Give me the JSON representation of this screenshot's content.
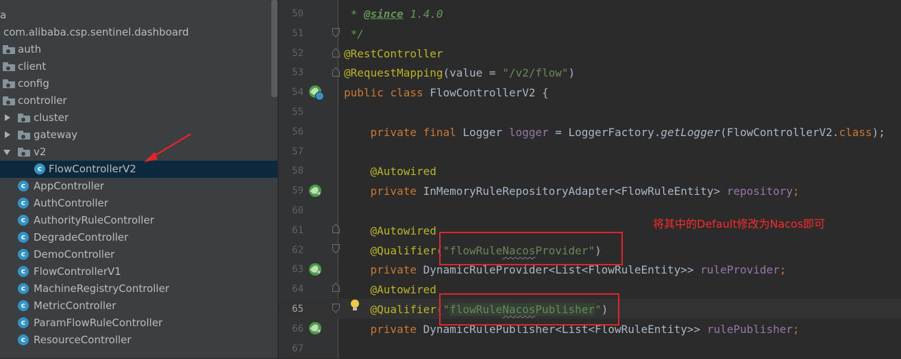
{
  "project_tree": {
    "items": [
      {
        "label": "a",
        "type": "text",
        "depth": 0
      },
      {
        "label": "com.alibaba.csp.sentinel.dashboard",
        "type": "package"
      },
      {
        "label": "auth",
        "type": "folder"
      },
      {
        "label": "client",
        "type": "folder"
      },
      {
        "label": "config",
        "type": "folder"
      },
      {
        "label": "controller",
        "type": "folder"
      },
      {
        "label": "cluster",
        "type": "folder",
        "expander": "collapsed"
      },
      {
        "label": "gateway",
        "type": "folder",
        "expander": "collapsed"
      },
      {
        "label": "v2",
        "type": "folder",
        "expander": "expanded"
      },
      {
        "label": "FlowControllerV2",
        "type": "class",
        "selected": true
      },
      {
        "label": "AppController",
        "type": "class"
      },
      {
        "label": "AuthController",
        "type": "class"
      },
      {
        "label": "AuthorityRuleController",
        "type": "class"
      },
      {
        "label": "DegradeController",
        "type": "class"
      },
      {
        "label": "DemoController",
        "type": "class"
      },
      {
        "label": "FlowControllerV1",
        "type": "class"
      },
      {
        "label": "MachineRegistryController",
        "type": "class"
      },
      {
        "label": "MetricController",
        "type": "class"
      },
      {
        "label": "ParamFlowRuleController",
        "type": "class"
      },
      {
        "label": "ResourceController",
        "type": "class"
      }
    ],
    "class_icon_letter": "c"
  },
  "editor": {
    "current_line": "65",
    "lines": [
      {
        "n": "50",
        "tokens": [
          [
            " * ",
            "cmt"
          ],
          [
            "@since",
            "tag"
          ],
          [
            " 1.4.0",
            "cmt"
          ]
        ]
      },
      {
        "n": "51",
        "tokens": [
          [
            " */",
            "cmt"
          ]
        ]
      },
      {
        "n": "52",
        "tokens": [
          [
            "@RestController",
            "ann"
          ]
        ]
      },
      {
        "n": "53",
        "tokens": [
          [
            "@RequestMapping",
            "ann"
          ],
          [
            "(value = ",
            ""
          ],
          [
            "\"/v2/flow\"",
            "str"
          ],
          [
            ")",
            ""
          ]
        ]
      },
      {
        "n": "54",
        "tokens": [
          [
            "public ",
            "kw"
          ],
          [
            "class ",
            "kw"
          ],
          [
            "FlowControllerV2 {",
            ""
          ]
        ]
      },
      {
        "n": "55",
        "tokens": []
      },
      {
        "n": "56",
        "tokens": [
          [
            "    ",
            ""
          ],
          [
            "private ",
            "kw"
          ],
          [
            "final ",
            "kw"
          ],
          [
            "Logger ",
            ""
          ],
          [
            "logger",
            "fld"
          ],
          [
            " = LoggerFactory.",
            ""
          ],
          [
            "getLogger",
            "mth"
          ],
          [
            "(FlowControllerV2.",
            ""
          ],
          [
            "class",
            "kw"
          ],
          [
            ");",
            ""
          ]
        ]
      },
      {
        "n": "57",
        "tokens": []
      },
      {
        "n": "58",
        "tokens": [
          [
            "    ",
            ""
          ],
          [
            "@Autowired",
            "ann"
          ]
        ]
      },
      {
        "n": "59",
        "tokens": [
          [
            "    ",
            ""
          ],
          [
            "private ",
            "kw"
          ],
          [
            "InMemoryRuleRepositoryAdapter<FlowRuleEntity> ",
            ""
          ],
          [
            "repository",
            "fld"
          ],
          [
            ";",
            "kw"
          ]
        ]
      },
      {
        "n": "60",
        "tokens": []
      },
      {
        "n": "61",
        "tokens": [
          [
            "    ",
            ""
          ],
          [
            "@Autowired",
            "ann"
          ]
        ]
      },
      {
        "n": "62",
        "tokens": [
          [
            "    ",
            ""
          ],
          [
            "@Qualifier",
            "ann"
          ],
          [
            "(",
            ""
          ],
          [
            "\"flowRule",
            "str"
          ],
          [
            "Nacos",
            "str typo"
          ],
          [
            "Provider\"",
            "str"
          ],
          [
            ")",
            ""
          ]
        ]
      },
      {
        "n": "63",
        "tokens": [
          [
            "    ",
            ""
          ],
          [
            "private ",
            "kw"
          ],
          [
            "DynamicRuleProvider<List<FlowRuleEntity>> ",
            ""
          ],
          [
            "ruleProvider",
            "fld"
          ],
          [
            ";",
            "kw"
          ]
        ]
      },
      {
        "n": "64",
        "tokens": [
          [
            "    ",
            ""
          ],
          [
            "@Autowired",
            "ann"
          ]
        ]
      },
      {
        "n": "65",
        "tokens": [
          [
            "    ",
            ""
          ],
          [
            "@Qualifier",
            "ann"
          ],
          [
            "(\"",
            "str"
          ],
          [
            "flowRule",
            "str hl-str"
          ],
          [
            "Nacos",
            "str typo hl-str"
          ],
          [
            "Publisher",
            "str hl-str"
          ],
          [
            "\"",
            "str"
          ],
          [
            ")",
            ""
          ]
        ]
      },
      {
        "n": "66",
        "tokens": [
          [
            "    ",
            ""
          ],
          [
            "private ",
            "kw"
          ],
          [
            "DynamicRulePublisher<List<FlowRuleEntity>> ",
            ""
          ],
          [
            "rulePublisher",
            "fld"
          ],
          [
            ";",
            "kw"
          ]
        ]
      },
      {
        "n": "67",
        "tokens": []
      }
    ]
  },
  "annotation_note": "将其中的Default修改为Nacos即可",
  "colors": {
    "annotation_red": "#e0262a",
    "selection": "#0d293e",
    "keyword": "#cc7832",
    "string": "#6a8759",
    "field": "#9876aa",
    "annotation": "#bbb529"
  }
}
